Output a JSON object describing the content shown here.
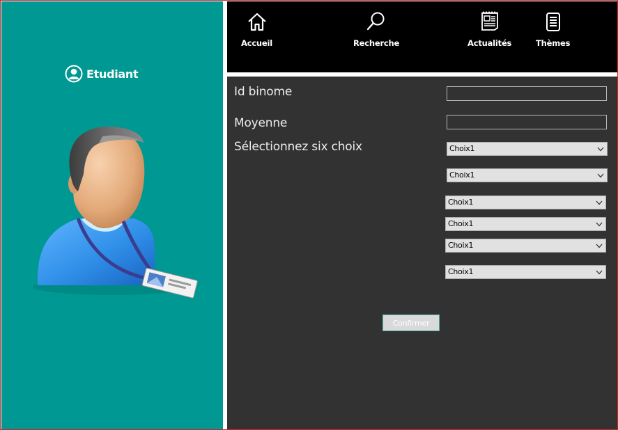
{
  "sidebar": {
    "header_icon": "user-circle-icon",
    "header_label": "Etudiant",
    "avatar_image": "student-avatar",
    "background_color": "#009893"
  },
  "nav": {
    "items": [
      {
        "icon": "home-icon",
        "label": "Accueil"
      },
      {
        "icon": "search-icon",
        "label": "Recherche"
      },
      {
        "icon": "newspaper-icon",
        "label": "Actualités"
      },
      {
        "icon": "document-list-icon",
        "label": "Thèmes"
      }
    ]
  },
  "form": {
    "id_binome_label": "Id binome",
    "id_binome_value": "",
    "moyenne_label": "Moyenne",
    "moyenne_value": "",
    "choices_label": "Sélectionnez six choix",
    "choices": [
      "Choix1",
      "Choix1",
      "Choix1",
      "Choix1",
      "Choix1",
      "Choix1"
    ],
    "confirm_label": "Confirmer"
  },
  "colors": {
    "main_background": "#323232",
    "topbar_background": "#000000",
    "window_border": "#c8282c"
  }
}
